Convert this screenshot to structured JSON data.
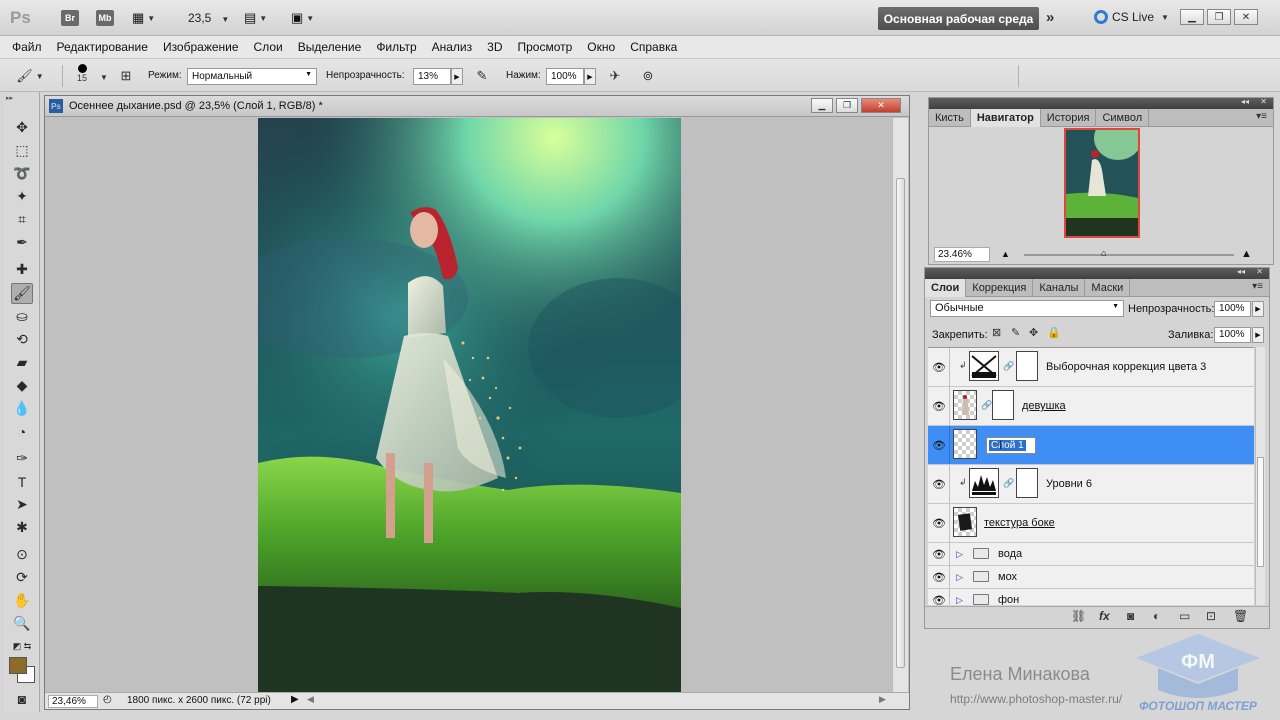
{
  "appbar": {
    "logo": "Ps",
    "bridge": "Br",
    "minibridge": "Mb",
    "zoom": "23,5",
    "workspace": "Основная рабочая среда",
    "cslive": "CS Live"
  },
  "menu": [
    "Файл",
    "Редактирование",
    "Изображение",
    "Слои",
    "Выделение",
    "Фильтр",
    "Анализ",
    "3D",
    "Просмотр",
    "Окно",
    "Справка"
  ],
  "options": {
    "brush_size": "15",
    "mode_label": "Режим:",
    "mode_value": "Нормальный",
    "opacity_label": "Непрозрачность:",
    "opacity_value": "13%",
    "flow_label": "Нажим:",
    "flow_value": "100%"
  },
  "document": {
    "title": "Осеннее дыхание.psd @ 23,5% (Слой 1, RGB/8) *",
    "zoom": "23,46%",
    "info": "1800 пикс. x 2600 пикс. (72 ppi)"
  },
  "navigator": {
    "tabs": [
      "Кисть",
      "Навигатор",
      "История",
      "Символ"
    ],
    "active_tab": 1,
    "zoom": "23.46%"
  },
  "layers_panel": {
    "tabs": [
      "Слои",
      "Коррекция",
      "Каналы",
      "Маски"
    ],
    "active_tab": 0,
    "blend_mode": "Обычные",
    "opacity_label": "Непрозрачность:",
    "opacity_value": "100%",
    "lock_label": "Закрепить:",
    "fill_label": "Заливка:",
    "fill_value": "100%",
    "layers": [
      {
        "name": "Выборочная коррекция цвета 3",
        "type": "adjustment",
        "clipped": true
      },
      {
        "name": "девушка",
        "type": "image-mask",
        "clipped": false
      },
      {
        "name": "Слой 1",
        "type": "empty",
        "selected": true,
        "renaming": true
      },
      {
        "name": "Уровни 6",
        "type": "adjustment",
        "clipped": true
      },
      {
        "name": "текстура боке",
        "type": "image"
      },
      {
        "name": "вода",
        "type": "group"
      },
      {
        "name": "мох",
        "type": "group"
      },
      {
        "name": "фон",
        "type": "group"
      }
    ]
  },
  "watermark": {
    "author": "Елена Минакова",
    "url": "http://www.photoshop-master.ru/",
    "logo_text": "ФОТОШОП МАСТЕР"
  }
}
